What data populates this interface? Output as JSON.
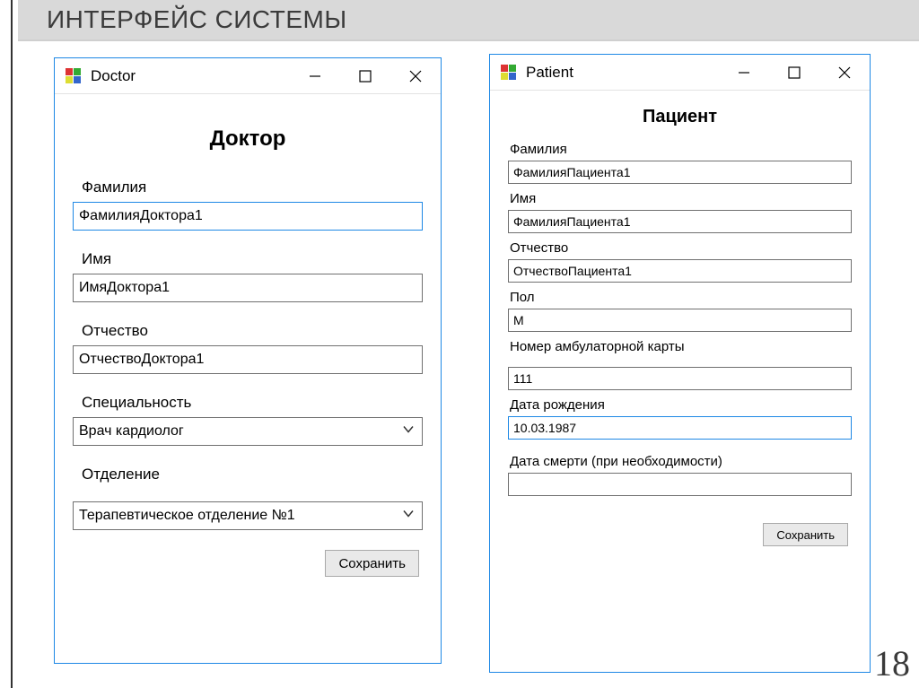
{
  "slide": {
    "title": "ИНТЕРФЕЙС СИСТЕМЫ",
    "page_number": "18"
  },
  "doctor": {
    "window_title": "Doctor",
    "heading": "Доктор",
    "fields": {
      "lastname": {
        "label": "Фамилия",
        "value": "ФамилияДоктора1"
      },
      "firstname": {
        "label": "Имя",
        "value": "ИмяДоктора1"
      },
      "patronymic": {
        "label": "Отчество",
        "value": "ОтчествоДоктора1"
      },
      "specialty": {
        "label": "Специальность",
        "value": "Врач кардиолог"
      },
      "department": {
        "label": "Отделение",
        "value": "Терапевтическое отделение №1"
      }
    },
    "save_label": "Сохранить"
  },
  "patient": {
    "window_title": "Patient",
    "heading": "Пациент",
    "fields": {
      "lastname": {
        "label": "Фамилия",
        "value": "ФамилияПациента1"
      },
      "firstname": {
        "label": "Имя",
        "value": "ФамилияПациента1"
      },
      "patronymic": {
        "label": "Отчество",
        "value": "ОтчествоПациента1"
      },
      "gender": {
        "label": "Пол",
        "value": "М"
      },
      "card_number": {
        "label": "Номер амбулаторной карты",
        "value": "111"
      },
      "dob": {
        "label": "Дата рождения",
        "value": "10.03.1987"
      },
      "dod": {
        "label": "Дата смерти (при необходимости)",
        "value": ""
      }
    },
    "save_label": "Сохранить"
  }
}
